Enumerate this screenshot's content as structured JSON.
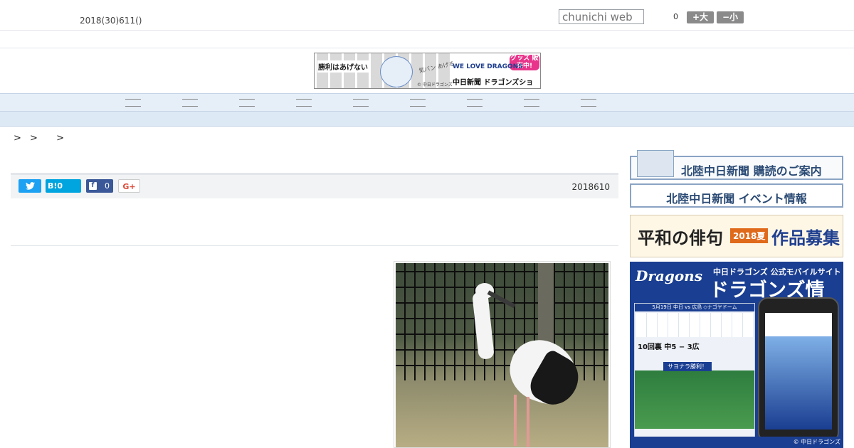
{
  "header": {
    "date": "2018(30)611()",
    "search_placeholder": "chunichi web",
    "font_count": "0",
    "font_big_label": "+大",
    "font_small_label": "−小"
  },
  "top_banner": {
    "slogan": "勝利はあげない",
    "handwritten": "気バン あげる",
    "we_love": "WE LOVE DRAGONS",
    "shop": "中日新聞 ドラゴンズショップ",
    "goods": "グッズ 販売中!",
    "copyright": "© 中日ドラゴンズ"
  },
  "share": {
    "twitter_icon": "twitter-bird-icon",
    "hatena_label": "B!0",
    "facebook_count": "0",
    "gplus_label": "G+",
    "article_date": "2018610"
  },
  "breadcrumb": [
    ">",
    ">",
    ">"
  ],
  "sidebar": {
    "subscribe": "北陸中日新聞 購読のご案内",
    "events": "北陸中日新聞 イベント情報",
    "haiku_title": "平和の俳句",
    "haiku_tag": "2018夏",
    "haiku_tail": "作品募集",
    "dragons_logo": "Dragons",
    "dragons_sub": "中日ドラゴンズ 公式モバイルサイト",
    "dragons_big": "ドラゴンズ情報",
    "board_header": "5月19日 中日 vs 広島 ◇ナゴヤドーム",
    "board_score": "10回裏 中5 − 3広",
    "board_win": "サヨナラ勝利！",
    "dragons_copyright": "© 中日ドラゴンズ"
  },
  "colors": {
    "nav_bg": "#e6eef8",
    "twitter": "#1da1f2",
    "hatena": "#00a4de",
    "facebook": "#3b5998",
    "dragons_blue": "#1a3e91"
  }
}
